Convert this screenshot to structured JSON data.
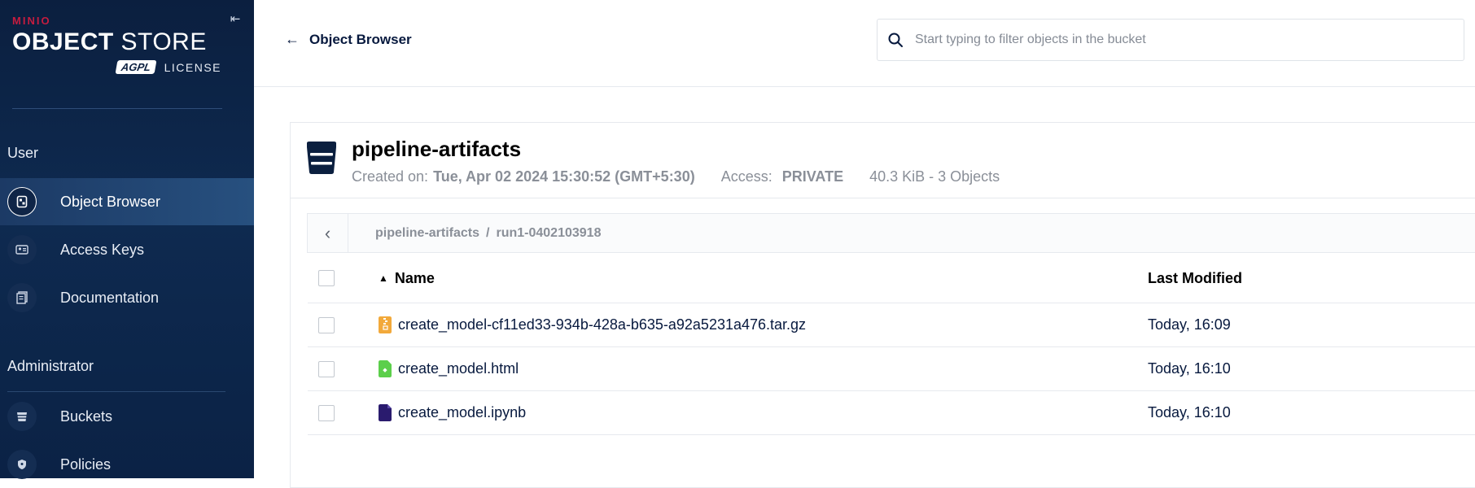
{
  "sidebar": {
    "logo": {
      "brand": "MINIO",
      "product_bold": "OBJECT",
      "product_light": " STORE",
      "badge": "AGPL",
      "license": "LICENSE"
    },
    "sections": [
      {
        "label": "User"
      },
      {
        "label": "Administrator"
      }
    ],
    "items": [
      {
        "label": "Object Browser",
        "icon": "object-browser-icon",
        "active": true
      },
      {
        "label": "Access Keys",
        "icon": "access-keys-icon",
        "active": false
      },
      {
        "label": "Documentation",
        "icon": "documentation-icon",
        "active": false
      },
      {
        "label": "Buckets",
        "icon": "buckets-icon",
        "active": false
      },
      {
        "label": "Policies",
        "icon": "policies-icon",
        "active": false
      }
    ]
  },
  "header": {
    "back_label": "Object Browser",
    "search_placeholder": "Start typing to filter objects in the bucket"
  },
  "bucket": {
    "name": "pipeline-artifacts",
    "created_label": "Created on:",
    "created_value": "Tue, Apr 02 2024 15:30:52 (GMT+5:30)",
    "access_label": "Access:",
    "access_value": "PRIVATE",
    "summary": "40.3 KiB - 3 Objects"
  },
  "breadcrumb": {
    "parts": [
      "pipeline-artifacts",
      "/",
      "run1-0402103918"
    ]
  },
  "table": {
    "columns": {
      "name": "Name",
      "modified": "Last Modified"
    },
    "rows": [
      {
        "name": "create_model-cf11ed33-934b-428a-b635-a92a5231a476.tar.gz",
        "modified": "Today, 16:09",
        "icon": "archive-file-icon",
        "color": "#f2a93b"
      },
      {
        "name": "create_model.html",
        "modified": "Today, 16:10",
        "icon": "html-file-icon",
        "color": "#5ccf4b"
      },
      {
        "name": "create_model.ipynb",
        "modified": "Today, 16:10",
        "icon": "notebook-file-icon",
        "color": "#2a1b6e"
      }
    ]
  },
  "colors": {
    "sidebar_bg": "#0b1f3f",
    "active_item_bg": "#27507f",
    "brand_red": "#c51c3f",
    "text_primary": "#07193e",
    "text_muted": "#8a8f98"
  }
}
